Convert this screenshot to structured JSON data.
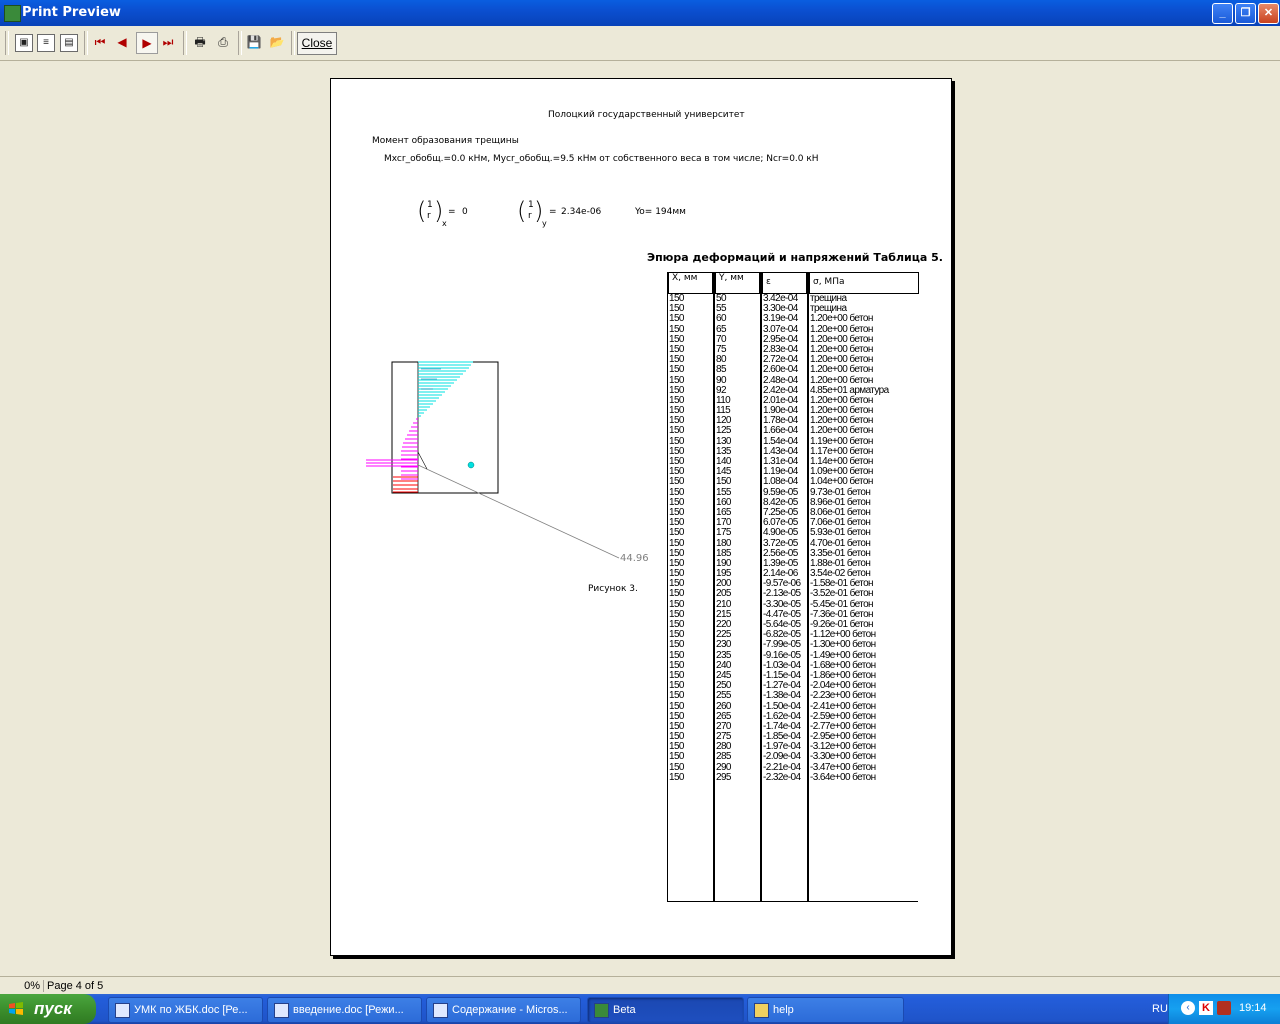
{
  "window": {
    "title": "Print Preview",
    "close_label": "Close"
  },
  "toolbar": {
    "icons": [
      "one-page-icon",
      "two-pages-icon",
      "zoom-icon",
      "first-page-icon",
      "prev-page-icon",
      "next-page-icon",
      "last-page-icon",
      "print-setup-icon",
      "print-icon",
      "save-icon",
      "open-icon"
    ]
  },
  "page": {
    "university": "Полоцкий государственный университет",
    "heading": "Момент образования трещины",
    "moments": "Mxcr_обобщ.=0.0 кНм, Mycr_обобщ.=9.5 кНм от собственного веса в том числе;     Ncr=0.0 кН",
    "curvature_x": "0",
    "curvature_y": "2.34e-06",
    "y0": "Yo= 194мм",
    "one": "1",
    "r": "r",
    "sub_x": "x",
    "sub_y": "y",
    "eq": "=",
    "table_title": "Эпюра деформаций и напряжений    Таблица 5.",
    "figure_caption": "Рисунок 3.",
    "diagram_value": "44.96",
    "table": {
      "headers": [
        "X, мм",
        "Y, мм",
        "ε",
        "σ, МПа"
      ],
      "x": [
        "150",
        "150",
        "150",
        "150",
        "150",
        "150",
        "150",
        "150",
        "150",
        "150",
        "150",
        "150",
        "150",
        "150",
        "150",
        "150",
        "150",
        "150",
        "150",
        "150",
        "150",
        "150",
        "150",
        "150",
        "150",
        "150",
        "150",
        "150",
        "150",
        "150",
        "150",
        "150",
        "150",
        "150",
        "150",
        "150",
        "150",
        "150",
        "150",
        "150",
        "150",
        "150",
        "150",
        "150",
        "150",
        "150",
        "150",
        "150"
      ],
      "y": [
        "50",
        "55",
        "60",
        "65",
        "70",
        "75",
        "80",
        "85",
        "90",
        "92",
        "110",
        "115",
        "120",
        "125",
        "130",
        "135",
        "140",
        "145",
        "150",
        "155",
        "160",
        "165",
        "170",
        "175",
        "180",
        "185",
        "190",
        "195",
        "200",
        "205",
        "210",
        "215",
        "220",
        "225",
        "230",
        "235",
        "240",
        "245",
        "250",
        "255",
        "260",
        "265",
        "270",
        "275",
        "280",
        "285",
        "290",
        "295"
      ],
      "eps": [
        "3.42e-04",
        "3.30e-04",
        "3.19e-04",
        "3.07e-04",
        "2.95e-04",
        "2.83e-04",
        "2.72e-04",
        "2.60e-04",
        "2.48e-04",
        "2.42e-04",
        "2.01e-04",
        "1.90e-04",
        "1.78e-04",
        "1.66e-04",
        "1.54e-04",
        "1.43e-04",
        "1.31e-04",
        "1.19e-04",
        "1.08e-04",
        "9.59e-05",
        "8.42e-05",
        "7.25e-05",
        "6.07e-05",
        "4.90e-05",
        "3.72e-05",
        "2.56e-05",
        "1.39e-05",
        "2.14e-06",
        "-9.57e-06",
        "-2.13e-05",
        "-3.30e-05",
        "-4.47e-05",
        "-5.64e-05",
        "-6.82e-05",
        "-7.99e-05",
        "-9.16e-05",
        "-1.03e-04",
        "-1.15e-04",
        "-1.27e-04",
        "-1.38e-04",
        "-1.50e-04",
        "-1.62e-04",
        "-1.74e-04",
        "-1.85e-04",
        "-1.97e-04",
        "-2.09e-04",
        "-2.21e-04",
        "-2.32e-04"
      ],
      "sigma": [
        "трещина",
        "трещина",
        "1.20e+00 бетон",
        "1.20e+00 бетон",
        "1.20e+00 бетон",
        "1.20e+00 бетон",
        "1.20e+00 бетон",
        "1.20e+00 бетон",
        "1.20e+00 бетон",
        "4.85e+01 арматура",
        "1.20e+00 бетон",
        "1.20e+00 бетон",
        "1.20e+00 бетон",
        "1.20e+00 бетон",
        "1.19e+00 бетон",
        "1.17e+00 бетон",
        "1.14e+00 бетон",
        "1.09e+00 бетон",
        "1.04e+00 бетон",
        "9.73e-01 бетон",
        "8.96e-01 бетон",
        "8.06e-01 бетон",
        "7.06e-01 бетон",
        "5.93e-01 бетон",
        "4.70e-01 бетон",
        "3.35e-01 бетон",
        "1.88e-01 бетон",
        "3.54e-02 бетон",
        "-1.58e-01 бетон",
        "-3.52e-01 бетон",
        "-5.45e-01 бетон",
        "-7.36e-01 бетон",
        "-9.26e-01 бетон",
        "-1.12e+00 бетон",
        "-1.30e+00 бетон",
        "-1.49e+00 бетон",
        "-1.68e+00 бетон",
        "-1.86e+00 бетон",
        "-2.04e+00 бетон",
        "-2.23e+00 бетон",
        "-2.41e+00 бетон",
        "-2.59e+00 бетон",
        "-2.77e+00 бетон",
        "-2.95e+00 бетон",
        "-3.12e+00 бетон",
        "-3.30e+00 бетон",
        "-3.47e+00 бетон",
        "-3.64e+00 бетон"
      ]
    }
  },
  "status": {
    "zoom": "0%",
    "page": "Page 4 of 5"
  },
  "taskbar": {
    "start_label": "пуск",
    "tasks": [
      "УМК по ЖБК.doc [Ре...",
      "введение.doc [Режи...",
      "Содержание - Micros...",
      "Beta",
      "help"
    ],
    "lang": "RU",
    "clock": "19:14"
  },
  "colors": {
    "compression": "#ff00ff",
    "tension": "#00ffff",
    "rebar": "#ff0000"
  }
}
